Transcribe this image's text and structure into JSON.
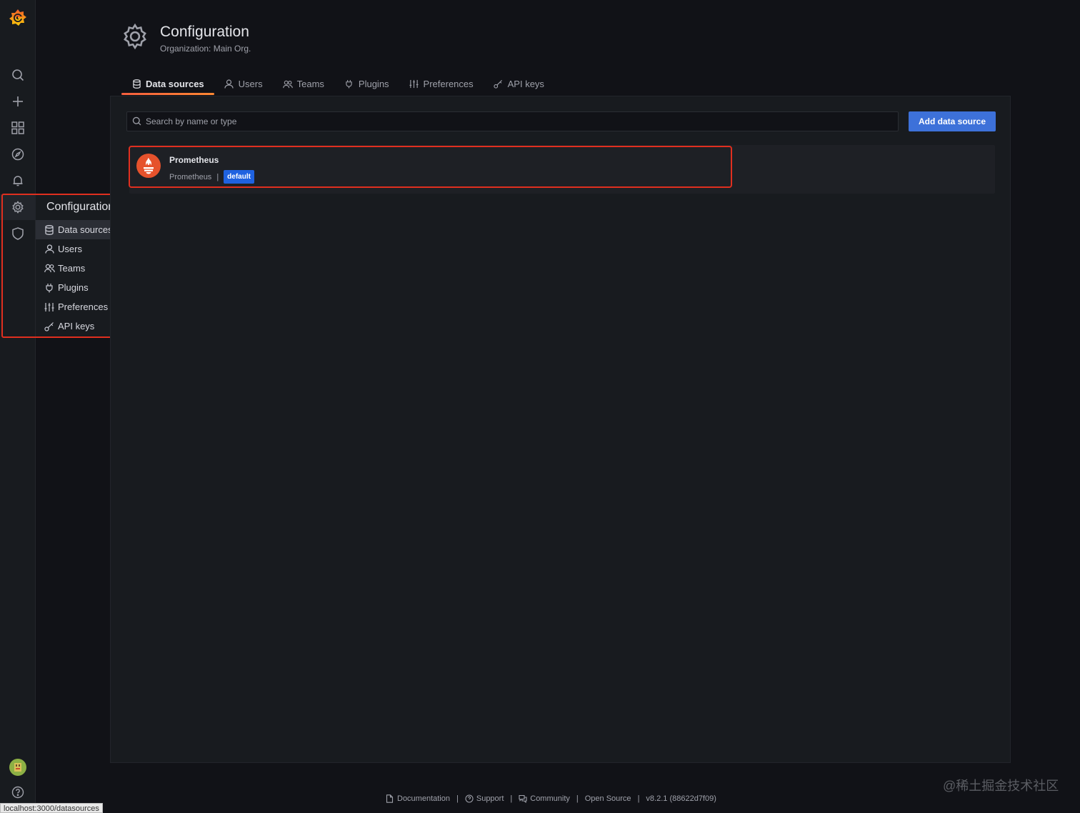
{
  "sidebar": {
    "icons": [
      "grafana-logo-icon",
      "search-icon",
      "plus-icon",
      "dashboards-icon",
      "explore-icon",
      "alerting-icon",
      "configuration-icon",
      "server-admin-icon",
      "avatar",
      "help-icon"
    ]
  },
  "flyout": {
    "title": "Configuration",
    "items": [
      {
        "label": "Data sources",
        "icon": "database-icon"
      },
      {
        "label": "Users",
        "icon": "user-icon"
      },
      {
        "label": "Teams",
        "icon": "users-icon"
      },
      {
        "label": "Plugins",
        "icon": "plug-icon"
      },
      {
        "label": "Preferences",
        "icon": "sliders-icon"
      },
      {
        "label": "API keys",
        "icon": "key-icon"
      }
    ]
  },
  "header": {
    "title": "Configuration",
    "subtitle": "Organization: Main Org."
  },
  "tabs": [
    {
      "label": "Data sources",
      "icon": "database-icon",
      "active": true
    },
    {
      "label": "Users",
      "icon": "user-icon"
    },
    {
      "label": "Teams",
      "icon": "users-icon"
    },
    {
      "label": "Plugins",
      "icon": "plug-icon"
    },
    {
      "label": "Preferences",
      "icon": "sliders-icon"
    },
    {
      "label": "API keys",
      "icon": "key-icon"
    }
  ],
  "search": {
    "placeholder": "Search by name or type",
    "value": ""
  },
  "add_button": "Add data source",
  "datasources": [
    {
      "name": "Prometheus",
      "type": "Prometheus",
      "badge": "default"
    }
  ],
  "footer": {
    "links": [
      {
        "label": "Documentation",
        "icon": "document-icon"
      },
      {
        "label": "Support",
        "icon": "question-icon"
      },
      {
        "label": "Community",
        "icon": "comments-icon"
      },
      {
        "label": "Open Source"
      },
      {
        "label": "v8.2.1 (88622d7f09)"
      }
    ]
  },
  "watermark": "@稀土掘金技术社区",
  "status_url": "localhost:3000/datasources",
  "colors": {
    "accent": "#3d71d9",
    "badge": "#1f62e0",
    "tab_underline": "#f55f3e",
    "annotation": "#e02f1f",
    "prometheus": "#e6522c"
  }
}
